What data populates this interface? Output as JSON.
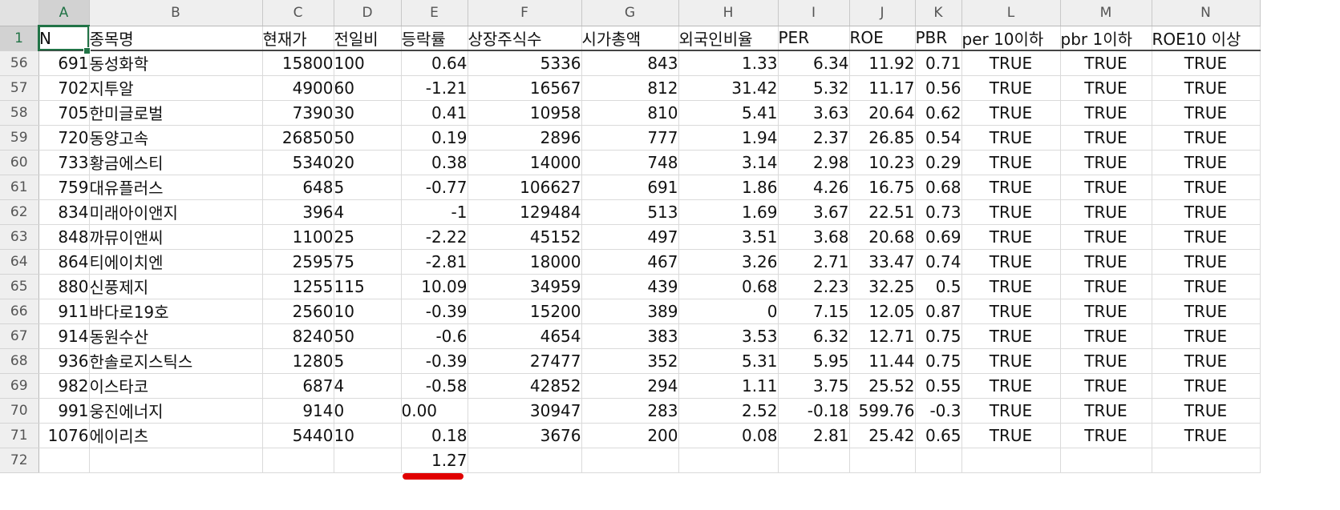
{
  "colors": {
    "accent": "#217346",
    "annotation": "#e00000"
  },
  "columns": [
    "A",
    "B",
    "C",
    "D",
    "E",
    "F",
    "G",
    "H",
    "I",
    "J",
    "K",
    "L",
    "M",
    "N"
  ],
  "header": {
    "row_num": "1",
    "cells": [
      "N",
      "종목명",
      "현재가",
      "전일비",
      "등락률",
      "상장주식수",
      "시가총액",
      "외국인비율",
      "PER",
      "ROE",
      "PBR",
      "per 10이하",
      "pbr 1이하",
      "ROE10 이상"
    ]
  },
  "rows": [
    {
      "num": "56",
      "cells": [
        "691",
        "동성화학",
        "15800",
        "100",
        "0.64",
        "5336",
        "843",
        "1.33",
        "6.34",
        "11.92",
        "0.71",
        "TRUE",
        "TRUE",
        "TRUE"
      ]
    },
    {
      "num": "57",
      "cells": [
        "702",
        "지투알",
        "4900",
        "60",
        "-1.21",
        "16567",
        "812",
        "31.42",
        "5.32",
        "11.17",
        "0.56",
        "TRUE",
        "TRUE",
        "TRUE"
      ]
    },
    {
      "num": "58",
      "cells": [
        "705",
        "한미글로벌",
        "7390",
        "30",
        "0.41",
        "10958",
        "810",
        "5.41",
        "3.63",
        "20.64",
        "0.62",
        "TRUE",
        "TRUE",
        "TRUE"
      ]
    },
    {
      "num": "59",
      "cells": [
        "720",
        "동양고속",
        "26850",
        "50",
        "0.19",
        "2896",
        "777",
        "1.94",
        "2.37",
        "26.85",
        "0.54",
        "TRUE",
        "TRUE",
        "TRUE"
      ]
    },
    {
      "num": "60",
      "cells": [
        "733",
        "황금에스티",
        "5340",
        "20",
        "0.38",
        "14000",
        "748",
        "3.14",
        "2.98",
        "10.23",
        "0.29",
        "TRUE",
        "TRUE",
        "TRUE"
      ]
    },
    {
      "num": "61",
      "cells": [
        "759",
        "대유플러스",
        "648",
        "5",
        "-0.77",
        "106627",
        "691",
        "1.86",
        "4.26",
        "16.75",
        "0.68",
        "TRUE",
        "TRUE",
        "TRUE"
      ]
    },
    {
      "num": "62",
      "cells": [
        "834",
        "미래아이앤지",
        "396",
        "4",
        "-1",
        "129484",
        "513",
        "1.69",
        "3.67",
        "22.51",
        "0.73",
        "TRUE",
        "TRUE",
        "TRUE"
      ]
    },
    {
      "num": "63",
      "cells": [
        "848",
        "까뮤이앤씨",
        "1100",
        "25",
        "-2.22",
        "45152",
        "497",
        "3.51",
        "3.68",
        "20.68",
        "0.69",
        "TRUE",
        "TRUE",
        "TRUE"
      ]
    },
    {
      "num": "64",
      "cells": [
        "864",
        "티에이치엔",
        "2595",
        "75",
        "-2.81",
        "18000",
        "467",
        "3.26",
        "2.71",
        "33.47",
        "0.74",
        "TRUE",
        "TRUE",
        "TRUE"
      ]
    },
    {
      "num": "65",
      "cells": [
        "880",
        "신풍제지",
        "1255",
        "115",
        "10.09",
        "34959",
        "439",
        "0.68",
        "2.23",
        "32.25",
        "0.5",
        "TRUE",
        "TRUE",
        "TRUE"
      ]
    },
    {
      "num": "66",
      "cells": [
        "911",
        "바다로19호",
        "2560",
        "10",
        "-0.39",
        "15200",
        "389",
        "0",
        "7.15",
        "12.05",
        "0.87",
        "TRUE",
        "TRUE",
        "TRUE"
      ]
    },
    {
      "num": "67",
      "cells": [
        "914",
        "동원수산",
        "8240",
        "50",
        "-0.6",
        "4654",
        "383",
        "3.53",
        "6.32",
        "12.71",
        "0.75",
        "TRUE",
        "TRUE",
        "TRUE"
      ]
    },
    {
      "num": "68",
      "cells": [
        "936",
        "한솔로지스틱스",
        "1280",
        "5",
        "-0.39",
        "27477",
        "352",
        "5.31",
        "5.95",
        "11.44",
        "0.75",
        "TRUE",
        "TRUE",
        "TRUE"
      ]
    },
    {
      "num": "69",
      "cells": [
        "982",
        "이스타코",
        "687",
        "4",
        "-0.58",
        "42852",
        "294",
        "1.11",
        "3.75",
        "25.52",
        "0.55",
        "TRUE",
        "TRUE",
        "TRUE"
      ]
    },
    {
      "num": "70",
      "cells": [
        "991",
        "웅진에너지",
        "914",
        "0",
        "0.00",
        "30947",
        "283",
        "2.52",
        "-0.18",
        "599.76",
        "-0.3",
        "TRUE",
        "TRUE",
        "TRUE"
      ]
    },
    {
      "num": "71",
      "cells": [
        "1076",
        "에이리츠",
        "5440",
        "10",
        "0.18",
        "3676",
        "200",
        "0.08",
        "2.81",
        "25.42",
        "0.65",
        "TRUE",
        "TRUE",
        "TRUE"
      ]
    },
    {
      "num": "72",
      "cells": [
        "",
        "",
        "",
        "",
        "1.27",
        "",
        "",
        "",
        "",
        "",
        "",
        "",
        "",
        ""
      ]
    }
  ]
}
